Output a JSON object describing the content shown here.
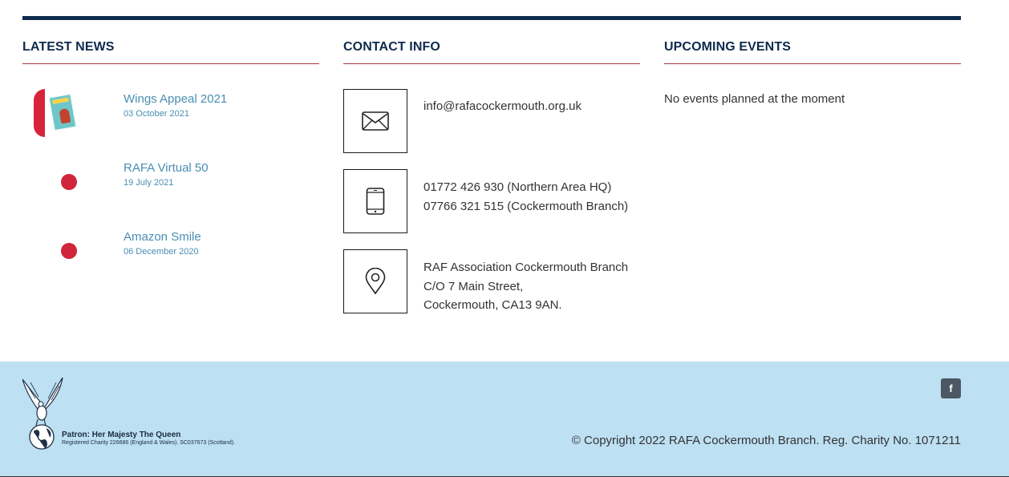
{
  "news": {
    "title": "LATEST NEWS",
    "items": [
      {
        "title": "Wings Appeal 2021",
        "date": "03 October 2021",
        "thumb": "wings-appeal-poster"
      },
      {
        "title": "RAFA Virtual 50",
        "date": "19 July 2021",
        "thumb": "raf-roundel"
      },
      {
        "title": "Amazon Smile",
        "date": "06 December 2020",
        "thumb": "raf-roundel"
      }
    ]
  },
  "contact": {
    "title": "CONTACT INFO",
    "email": "info@rafacockermouth.org.uk",
    "phones": [
      "01772 426 930 (Northern Area HQ)",
      "07766 321 515 (Cockermouth Branch)"
    ],
    "address": [
      "RAF Association Cockermouth Branch",
      "C/O 7 Main Street,",
      "Cockermouth, CA13 9AN."
    ],
    "icons": [
      "envelope-icon",
      "mobile-phone-icon",
      "map-pin-icon"
    ]
  },
  "events": {
    "title": "UPCOMING EVENTS",
    "empty_text": "No events planned at the moment"
  },
  "footer": {
    "patron": "Patron: Her Majesty The Queen",
    "registered": "Registered Charity 226686 (England & Wales). SC037673 (Scotland).",
    "facebook_icon": "facebook-icon",
    "copyright": "© Copyright 2022 RAFA Cockermouth Branch. Reg. Charity No. 1071211"
  },
  "colors": {
    "navy": "#0e2a4d",
    "accent_red": "#a8333f",
    "link_blue": "#4a8eb2",
    "footer_bg": "#bde0f3"
  }
}
